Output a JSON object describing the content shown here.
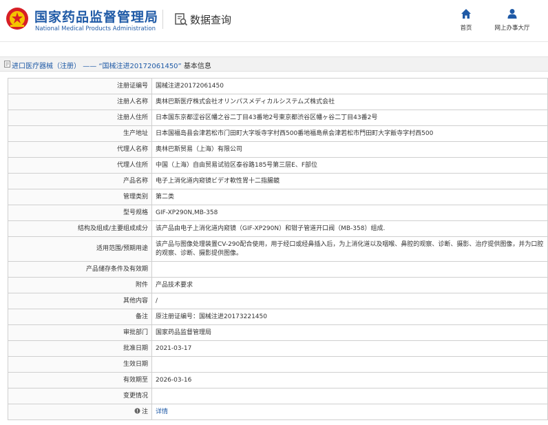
{
  "header": {
    "title": "国家药品监督管理局",
    "subtitle": "National Medical Products Administration",
    "section_title": "数据查询",
    "nav": [
      {
        "label": "首页",
        "icon": "home-icon"
      },
      {
        "label": "网上办事大厅",
        "icon": "user-icon"
      }
    ]
  },
  "breadcrumb": {
    "link": "进口医疗器械（注册）",
    "separator": "——",
    "current": "“国械注进20172061450”",
    "tail": "基本信息"
  },
  "rows": [
    {
      "label": "注册证编号",
      "value": "国械注进20172061450"
    },
    {
      "label": "注册人名称",
      "value": "奥林巴斯医疗株式会社オリンパスメディカルシステムズ株式会社"
    },
    {
      "label": "注册人住所",
      "value": "日本国东京都涩谷区幡之谷二丁目43番地2号東京都渋谷区幡ヶ谷二丁目43番2号"
    },
    {
      "label": "生产地址",
      "value": "日本国福岛县会津若松市门田町大字坂寺字村西500番地福島県会津若松市門田町大字飯寺字村西500"
    },
    {
      "label": "代理人名称",
      "value": "奥林巴斯贸易（上海）有限公司"
    },
    {
      "label": "代理人住所",
      "value": "中国（上海）自由贸易试验区泰谷路185号第三层E、F部位"
    },
    {
      "label": "产品名称",
      "value": "电子上消化道内窥镜ビデオ軟性胃十二指腸鏡"
    },
    {
      "label": "管理类别",
      "value": "第二类"
    },
    {
      "label": "型号规格",
      "value": "GIF-XP290N,MB-358"
    },
    {
      "label": "结构及组成/主要组成成分",
      "value": "该产品由电子上消化道内窥镜（GIF-XP290N）和钳子管道开口阀（MB-358）组成."
    },
    {
      "label": "适用范围/预期用途",
      "value": "该产品与图像处理装置CV-290配合使用，用于经口或经鼻插入后，为上消化道以及咽喉、鼻腔的观察、诊断、摄影、治疗提供图像，并为口腔的观察、诊断、摄影提供图像。",
      "tall": true
    },
    {
      "label": "产品储存条件及有效期",
      "value": ""
    },
    {
      "label": "附件",
      "value": "产品技术要求"
    },
    {
      "label": "其他内容",
      "value": "/"
    },
    {
      "label": "备注",
      "value": "原注册证编号：国械注进20173221450"
    },
    {
      "label": "审批部门",
      "value": "国家药品监督管理局"
    },
    {
      "label": "批准日期",
      "value": "2021-03-17"
    },
    {
      "label": "生效日期",
      "value": ""
    },
    {
      "label": "有效期至",
      "value": "2026-03-16"
    },
    {
      "label": "变更情况",
      "value": ""
    },
    {
      "label": "注",
      "value": "详情",
      "link": true
    }
  ]
}
